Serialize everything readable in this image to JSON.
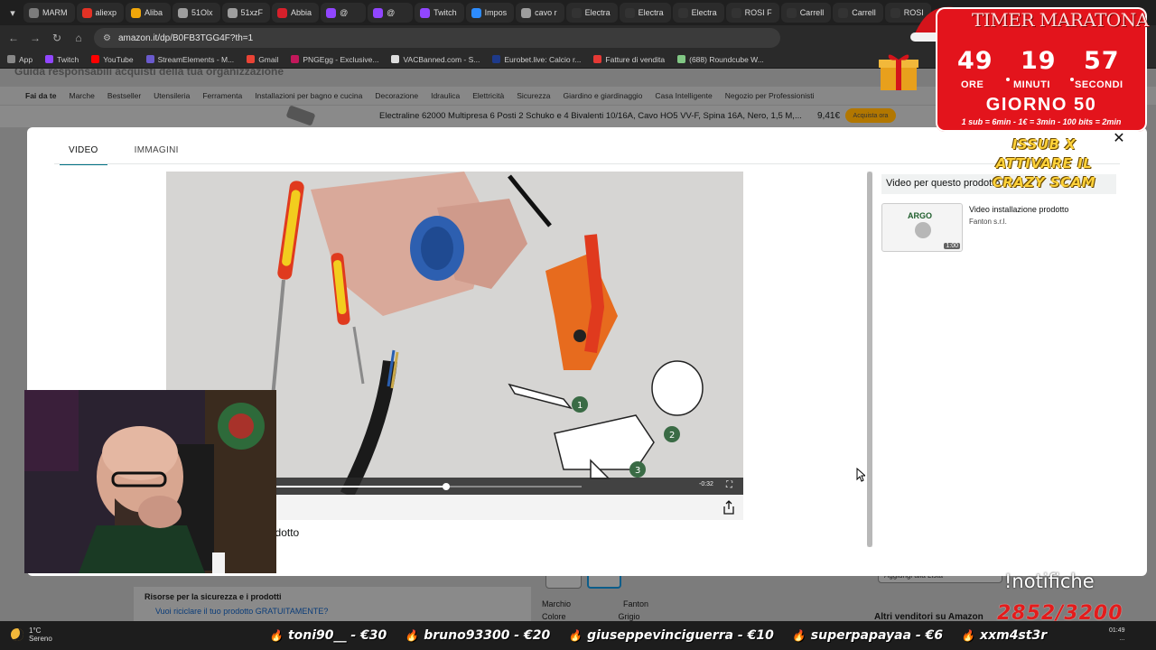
{
  "browser": {
    "tabs": [
      {
        "label": "MARM",
        "color": "#7c7c7c"
      },
      {
        "label": "aliexp",
        "color": "#e43225"
      },
      {
        "label": "Aliba",
        "color": "#f1a70a"
      },
      {
        "label": "51Olx",
        "color": "#9e9e9e"
      },
      {
        "label": "51xzF",
        "color": "#9e9e9e"
      },
      {
        "label": "Abbia",
        "color": "#d6202b"
      },
      {
        "label": "@",
        "color": "#9146ff"
      },
      {
        "label": "@",
        "color": "#9146ff"
      },
      {
        "label": "Twitch",
        "color": "#9146ff"
      },
      {
        "label": "Impos",
        "color": "#2d8cff"
      },
      {
        "label": "cavo r",
        "color": "#9e9e9e"
      },
      {
        "label": "Electra",
        "color": "#333333"
      },
      {
        "label": "Electra",
        "color": "#333333"
      },
      {
        "label": "Electra",
        "color": "#333333"
      },
      {
        "label": "ROSI F",
        "color": "#333333"
      },
      {
        "label": "Carrell",
        "color": "#333333"
      },
      {
        "label": "Carrell",
        "color": "#333333"
      },
      {
        "label": "ROSI",
        "color": "#333333"
      }
    ],
    "url": "amazon.it/dp/B0FB3TGG4F?th=1",
    "bookmarks": [
      {
        "label": "App",
        "color": "#888888"
      },
      {
        "label": "Twitch",
        "color": "#9146ff"
      },
      {
        "label": "YouTube",
        "color": "#ff0000"
      },
      {
        "label": "StreamElements - M...",
        "color": "#6a5acd"
      },
      {
        "label": "Gmail",
        "color": "#ea4335"
      },
      {
        "label": "PNGEgg - Exclusive...",
        "color": "#c2185b"
      },
      {
        "label": "VACBanned.com - S...",
        "color": "#dddddd"
      },
      {
        "label": "Eurobet.live: Calcio r...",
        "color": "#1e3a8a"
      },
      {
        "label": "Fatture di vendita",
        "color": "#e53935"
      },
      {
        "label": "(688) Roundcube W...",
        "color": "#81c784"
      }
    ]
  },
  "amazon": {
    "top_heading": "Guida responsabili acquisti della tua organizzazione",
    "nav": [
      "Fai da te",
      "Marche",
      "Bestseller",
      "Utensileria",
      "Ferramenta",
      "Installazioni per bagno e cucina",
      "Decorazione",
      "Idraulica",
      "Elettricità",
      "Sicurezza",
      "Giardino e giardinaggio",
      "Casa Intelligente",
      "Negozio per Professionisti"
    ],
    "sticky": {
      "title": "Electraline 62000 Multipresa 6 Posti 2 Schuko e 4 Bivalenti 10/16A, Cavo HO5 VV-F, Spina 16A, Nero, 1,5 M,...",
      "price": "9,41€",
      "buy_label": "Acquista ora"
    },
    "safety": {
      "title": "Risorse per la sicurezza e i prodotti",
      "link": "Vuoi riciclare il tuo prodotto GRATUITAMENTE?"
    },
    "attributes": [
      {
        "key": "Marchio",
        "value": "Fanton"
      },
      {
        "key": "Colore",
        "value": "Grigio"
      }
    ],
    "wishlist_label": "Aggiungi alla Lista",
    "other_sellers": "Altri venditori su Amazon"
  },
  "modal": {
    "tabs": [
      {
        "label": "VIDEO",
        "active": true
      },
      {
        "label": "IMMAGINI",
        "active": false
      }
    ],
    "video": {
      "time_remaining": "-0:32",
      "progress": 0.56,
      "caption": "Video installazione prodotto"
    },
    "sidebar": {
      "title": "Video per questo prodotto",
      "items": [
        {
          "title": "Video installazione prodotto",
          "author": "Fanton s.r.l.",
          "duration": "1:00",
          "brand": "ARGO"
        }
      ]
    }
  },
  "overlay": {
    "timer": {
      "title": "TIMER MARATONA",
      "hours": "49",
      "minutes": "19",
      "seconds": "57",
      "hours_label": "ORE",
      "minutes_label": "MINUTI",
      "seconds_label": "SECONDI",
      "day": "GIORNO 50",
      "rules": "1 sub = 6min - 1€ = 3min - 100 bits = 2min"
    },
    "promo": "ISSUB X ATTIVARE IL CRAZY SCAM",
    "notifiche": "!notifiche",
    "sub_count": "2852/3200",
    "ticker": [
      "toni90__ - €30",
      "bruno93300 - €20",
      "giuseppevinciguerra - €10",
      "superpapayaa - €6",
      "xxm4st3r"
    ]
  },
  "taskbar": {
    "temperature": "1°C",
    "weather": "Sereno",
    "time": "01:49",
    "date": "..."
  },
  "colors": {
    "amazon_teal": "#007185",
    "timer_red": "#e3141c",
    "promo_yellow": "#ffd23a"
  }
}
